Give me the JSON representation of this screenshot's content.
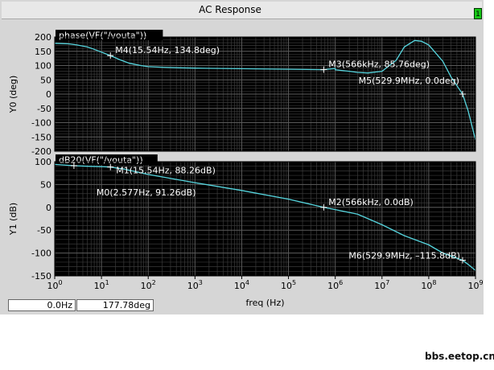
{
  "window": {
    "title": "AC Response",
    "badge": "1"
  },
  "colors": {
    "trace": "#56d6df",
    "plot_bg": "#000000",
    "grid": "#3a3a3a",
    "marker_text": "#ffffff",
    "window_bg": "#d6d6d6"
  },
  "readout": {
    "x": "0.0Hz",
    "y": "177.78deg"
  },
  "watermark": "bbs.eetop.cn",
  "chart_data": [
    {
      "type": "line",
      "trace_label": "phase(VF(\"/vouta\"))",
      "ylabel": "Y0 (deg)",
      "xlabel": "",
      "xscale": "log",
      "xlim": [
        1,
        1000000000
      ],
      "ylim": [
        -200,
        200
      ],
      "yticks": [
        -200,
        -150,
        -100,
        -50,
        0,
        50,
        100,
        150,
        200
      ],
      "grid": true,
      "series": [
        {
          "x": [
            1,
            2,
            3,
            5,
            7,
            10,
            15.54,
            25,
            40,
            70,
            100,
            200,
            500,
            1000,
            1000000,
            566000,
            1000000,
            2000000,
            3000000,
            5000000,
            10000000,
            20000000,
            30000000,
            50000000,
            70000000,
            100000000,
            200000000,
            300000000,
            529900000,
            700000000,
            1000000000
          ],
          "y": [
            178,
            176,
            172,
            165,
            157,
            147,
            134.8,
            120,
            108,
            100,
            96,
            94,
            92,
            91,
            90,
            85.76,
            85,
            80,
            76,
            74,
            80,
            118,
            165,
            188,
            185,
            172,
            115,
            60,
            0,
            -60,
            -160
          ]
        }
      ],
      "markers": [
        {
          "label": "M4(15.54Hz, 134.8deg)",
          "x": 15.54,
          "y": 134.8
        },
        {
          "label": "M3(566kHz, 85.76deg)",
          "x": 566000,
          "y": 85.76
        },
        {
          "label": "M5(529.9MHz, 0.0deg)",
          "x": 529900000,
          "y": 0.0
        }
      ]
    },
    {
      "type": "line",
      "trace_label": "dB20(VF(\"/vouta\"))",
      "ylabel": "Y1 (dB)",
      "xlabel": "freq (Hz)",
      "xscale": "log",
      "xlim": [
        1,
        1000000000
      ],
      "ylim": [
        -150,
        100
      ],
      "yticks": [
        -150,
        -100,
        -50,
        0,
        50,
        100
      ],
      "xticks": [
        1,
        10,
        100,
        1000,
        10000,
        100000,
        1000000,
        10000000,
        100000000,
        1000000000
      ],
      "grid": true,
      "series": [
        {
          "x": [
            1,
            2.577,
            5,
            10,
            15.54,
            30,
            100,
            1000,
            10000,
            100000,
            566000,
            1000000,
            3000000,
            10000000,
            30000000,
            100000000,
            200000000,
            529900000,
            700000000,
            1000000000
          ],
          "y": [
            94,
            91.26,
            90,
            89,
            88.26,
            84,
            72,
            54,
            37,
            18,
            0,
            -5,
            -15,
            -38,
            -62,
            -82,
            -100,
            -115.8,
            -125,
            -138
          ]
        }
      ],
      "markers": [
        {
          "label": "M1(15.54Hz, 88.26dB)",
          "x": 15.54,
          "y": 88.26
        },
        {
          "label": "M0(2.577Hz, 91.26dB)",
          "x": 2.577,
          "y": 91.26
        },
        {
          "label": "M2(566kHz, 0.0dB)",
          "x": 566000,
          "y": 0.0
        },
        {
          "label": "M6(529.9MHz, -115.8dB)",
          "x": 529900000,
          "y": -115.8
        }
      ]
    }
  ]
}
